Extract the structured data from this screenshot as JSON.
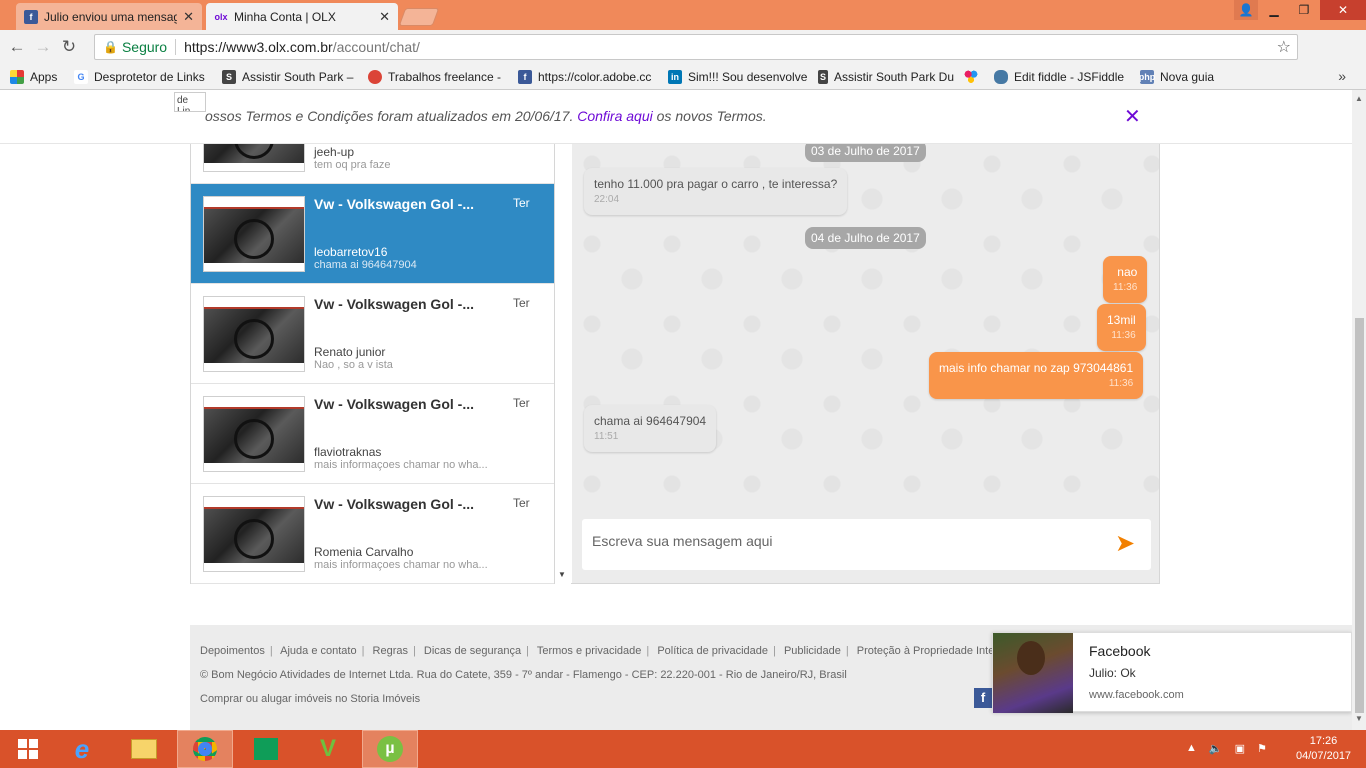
{
  "browser": {
    "tabs": [
      {
        "title": "Julio enviou uma mensag",
        "favicon": "facebook-icon",
        "active": false
      },
      {
        "title": "Minha Conta | OLX",
        "favicon": "olx-icon",
        "active": true
      }
    ],
    "address": {
      "secure_label": "Seguro",
      "host": "https://www3.olx.com.br",
      "path": "/account/chat/"
    },
    "extension_label": "{≡}",
    "bookmarks": [
      {
        "label": "Apps",
        "icon": "apps-grid-icon"
      },
      {
        "label": "Desprotetor de Links",
        "icon": "google-icon"
      },
      {
        "label": "Assistir South Park –",
        "icon": "southpark-icon"
      },
      {
        "label": "Trabalhos freelance -",
        "icon": "chrome-icon"
      },
      {
        "label": "https://color.adobe.cc",
        "icon": "facebook-icon"
      },
      {
        "label": "Sim!!! Sou desenvolve",
        "icon": "linkedin-icon"
      },
      {
        "label": "Assistir South Park Du",
        "icon": "southpark-icon"
      },
      {
        "label": "",
        "icon": "colorful-dots-icon"
      },
      {
        "label": "Edit fiddle - JSFiddle",
        "icon": "cloud-icon"
      },
      {
        "label": "Nova guia",
        "icon": "php-icon"
      }
    ],
    "tooltip": "de Lin"
  },
  "notice": {
    "text_before": "ossos Termos e Condições foram atualizados em 20/06/17.",
    "link": "Confira aqui",
    "text_after": "os novos Termos."
  },
  "conversations": [
    {
      "title": "",
      "day": "",
      "user": "jeeh-up",
      "last": "tem oq pra faze",
      "selected": false
    },
    {
      "title": "Vw - Volkswagen Gol -...",
      "day": "Ter",
      "user": "leobarretov16",
      "last": "chama ai 964647904",
      "selected": true
    },
    {
      "title": "Vw - Volkswagen Gol -...",
      "day": "Ter",
      "user": "Renato junior",
      "last": "Nao , so a v ista",
      "selected": false
    },
    {
      "title": "Vw - Volkswagen Gol -...",
      "day": "Ter",
      "user": "flaviotraknas",
      "last": "mais informaçoes chamar no wha...",
      "selected": false
    },
    {
      "title": "Vw - Volkswagen Gol -...",
      "day": "Ter",
      "user": "Romenia Carvalho",
      "last": "mais informaçoes chamar no wha...",
      "selected": false
    }
  ],
  "chat": {
    "dates": [
      "03 de Julho de 2017",
      "04 de Julho de 2017"
    ],
    "messages": [
      {
        "dir": "in",
        "text": "tenho 11.000 pra pagar o carro , te interessa?",
        "time": "22:04"
      },
      {
        "dir": "out",
        "text": "nao",
        "time": "11:36"
      },
      {
        "dir": "out",
        "text": "13mil",
        "time": "11:36"
      },
      {
        "dir": "out",
        "text": "mais info chamar no zap 973044861",
        "time": "11:36"
      },
      {
        "dir": "in",
        "text": "chama ai 964647904",
        "time": "11:51"
      }
    ],
    "input_placeholder": "Escreva sua mensagem aqui"
  },
  "footer": {
    "links": [
      "Depoimentos",
      "Ajuda e contato",
      "Regras",
      "Dicas de segurança",
      "Termos e privacidade",
      "Política de privacidade",
      "Publicidade",
      "Proteção à Propriedade Intelectual"
    ],
    "copyright": "© Bom Negócio Atividades de Internet Ltda. Rua do Catete, 359 - 7º andar - Flamengo - CEP: 22.220-001 - Rio de Janeiro/RJ, Brasil",
    "imoveis": "Comprar ou alugar imóveis no Storia Imóveis"
  },
  "notification": {
    "title": "Facebook",
    "message": "Julio: Ok",
    "url": "www.facebook.com"
  },
  "taskbar": {
    "clock_time": "17:26",
    "clock_date": "04/07/2017"
  },
  "colors": {
    "accent_olx": "#6e0ad6",
    "selected_blue": "#2f8ac4",
    "outgoing_orange": "#f9954a",
    "taskbar": "#d9522a"
  }
}
